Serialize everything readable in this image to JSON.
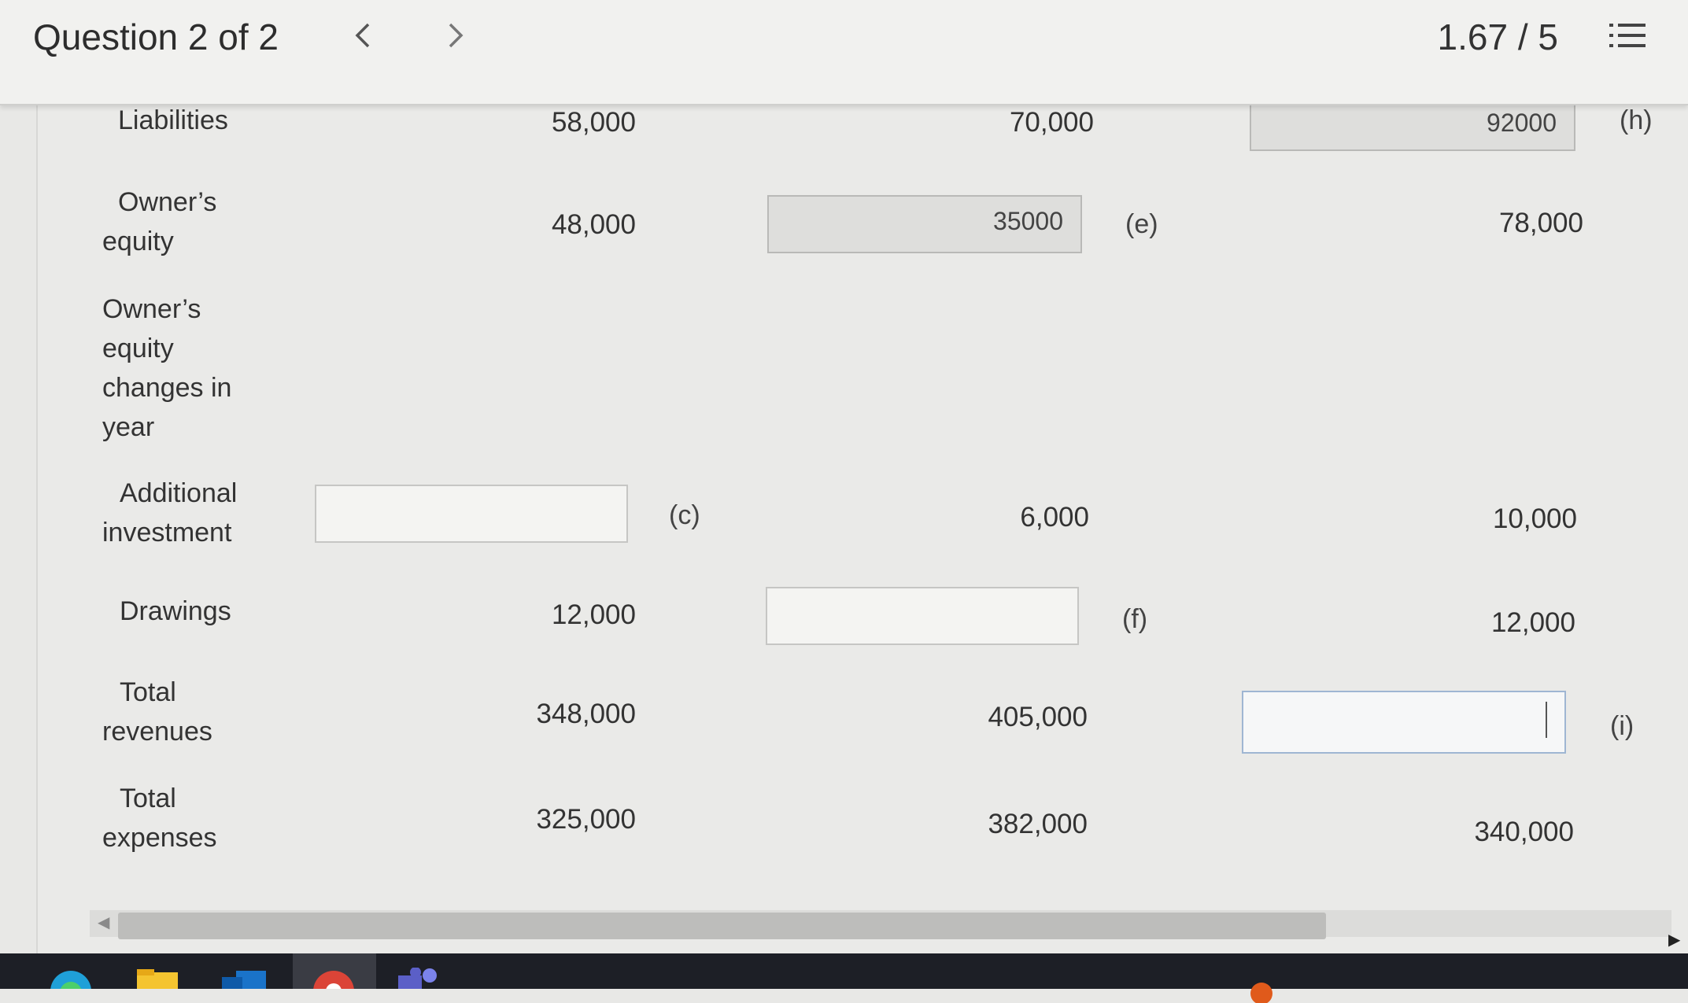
{
  "header": {
    "question_label": "Question 2 of 2",
    "prev_icon": "chevron-left-icon",
    "next_icon": "chevron-right-icon",
    "score": "1.67 / 5",
    "menu_icon": "numbered-list-icon"
  },
  "rows": {
    "liabilities": {
      "label": "Liabilities",
      "col1": "58,000",
      "col2": "70,000",
      "col3_input": "92000",
      "col3_tag": "(h)"
    },
    "owners_equity": {
      "label_line1": "Owner’s",
      "label_line2": "equity",
      "col1": "48,000",
      "col2_input": "35000",
      "col2_tag": "(e)",
      "col3": "78,000"
    },
    "equity_changes": {
      "line1": "Owner’s",
      "line2": "equity",
      "line3": "changes in",
      "line4": "year"
    },
    "additional_investment": {
      "label_line1": "Additional",
      "label_line2": "investment",
      "col1_input": "",
      "col1_tag": "(c)",
      "col2": "6,000",
      "col3": "10,000"
    },
    "drawings": {
      "label": "Drawings",
      "col1": "12,000",
      "col2_input": "",
      "col2_tag": "(f)",
      "col3": "12,000"
    },
    "total_revenues": {
      "label_line1": "Total",
      "label_line2": "revenues",
      "col1": "348,000",
      "col2": "405,000",
      "col3_input": "",
      "col3_tag": "(i)"
    },
    "total_expenses": {
      "label_line1": "Total",
      "label_line2": "expenses",
      "col1": "325,000",
      "col2": "382,000",
      "col3": "340,000"
    }
  },
  "colors": {
    "active_input_border": "#9fb6d3",
    "filled_input_bg": "#dededc"
  }
}
